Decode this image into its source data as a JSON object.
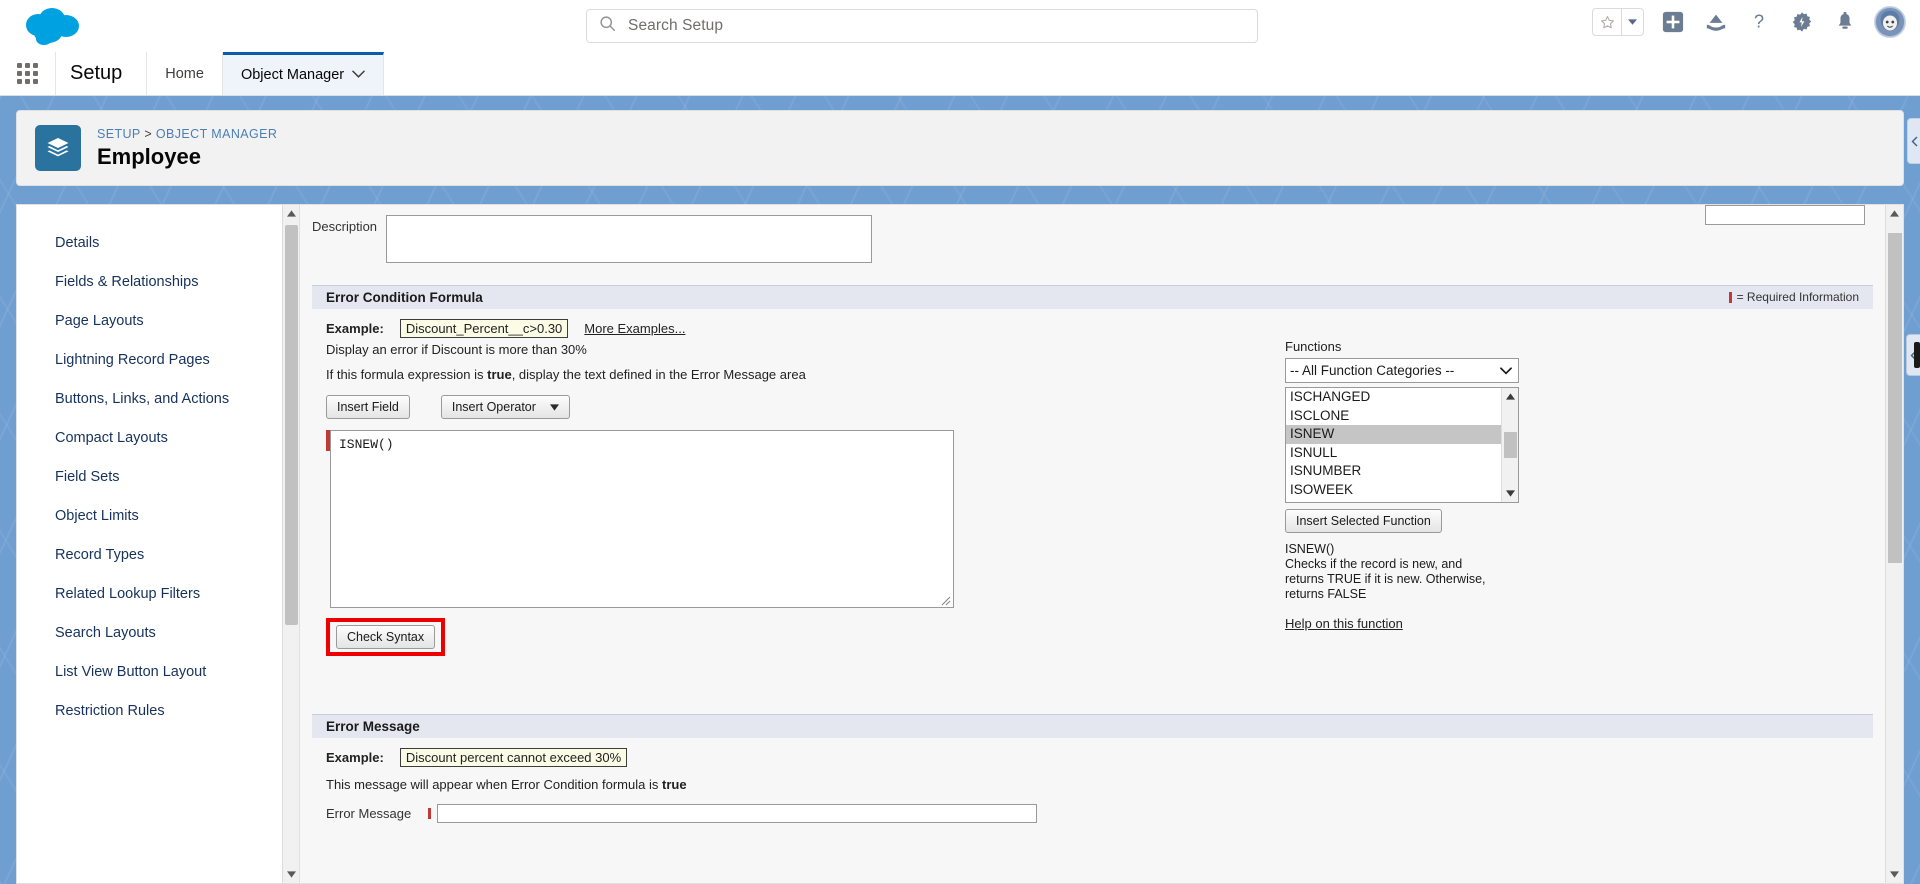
{
  "header": {
    "search_placeholder": "Search Setup",
    "search_icon": "search-icon",
    "logo_icon": "salesforce-cloud-logo",
    "icons": [
      {
        "name": "favorites-star-icon",
        "glyph": "star"
      },
      {
        "name": "favorites-caret-icon",
        "glyph": "caret-down"
      },
      {
        "name": "global-actions-plus-icon",
        "glyph": "plus"
      },
      {
        "name": "trailhead-icon",
        "glyph": "mountain"
      },
      {
        "name": "help-icon",
        "glyph": "question"
      },
      {
        "name": "setup-gear-icon",
        "glyph": "gear-lightning"
      },
      {
        "name": "notifications-bell-icon",
        "glyph": "bell"
      },
      {
        "name": "user-avatar",
        "glyph": "avatar"
      }
    ]
  },
  "setup_nav": {
    "app_launcher_icon": "app-launcher-waffle-icon",
    "title": "Setup",
    "tabs": [
      {
        "label": "Home",
        "active": false,
        "has_caret": false
      },
      {
        "label": "Object Manager",
        "active": true,
        "has_caret": true
      }
    ]
  },
  "record_header": {
    "icon": "object-stack-icon",
    "breadcrumb_root": "SETUP",
    "breadcrumb_sep": ">",
    "breadcrumb_current": "OBJECT MANAGER",
    "title": "Employee"
  },
  "sidebar": {
    "items": [
      {
        "label": "Details"
      },
      {
        "label": "Fields & Relationships"
      },
      {
        "label": "Page Layouts"
      },
      {
        "label": "Lightning Record Pages"
      },
      {
        "label": "Buttons, Links, and Actions"
      },
      {
        "label": "Compact Layouts"
      },
      {
        "label": "Field Sets"
      },
      {
        "label": "Object Limits"
      },
      {
        "label": "Record Types"
      },
      {
        "label": "Related Lookup Filters"
      },
      {
        "label": "Search Layouts"
      },
      {
        "label": "List View Button Layout"
      },
      {
        "label": "Restriction Rules"
      }
    ]
  },
  "form": {
    "description_label": "Description",
    "description_value": "",
    "required_legend": "= Required Information",
    "required_color": "#c23934",
    "highlight_color": "#ee0000"
  },
  "error_condition": {
    "section_title": "Error Condition Formula",
    "example_label": "Example:",
    "example_value": "Discount_Percent__c>0.30",
    "more_examples_link": "More Examples...",
    "example_note": "Display an error if Discount is more than 30%",
    "true_note_before": "If this formula expression is ",
    "true_note_bold": "true",
    "true_note_after": ", display the text defined in the Error Message area",
    "insert_field_button": "Insert Field",
    "insert_operator_button": "Insert Operator",
    "formula_value": "ISNEW()",
    "check_syntax_button": "Check Syntax"
  },
  "functions_panel": {
    "label": "Functions",
    "category_selected": "-- All Function Categories --",
    "list": [
      {
        "name": "ISCHANGED",
        "selected": false
      },
      {
        "name": "ISCLONE",
        "selected": false
      },
      {
        "name": "ISNEW",
        "selected": true
      },
      {
        "name": "ISNULL",
        "selected": false
      },
      {
        "name": "ISNUMBER",
        "selected": false
      },
      {
        "name": "ISOWEEK",
        "selected": false
      }
    ],
    "insert_button": "Insert Selected Function",
    "desc_signature": "ISNEW()",
    "desc_body": "Checks if the record is new, and returns TRUE if it is new. Otherwise, returns FALSE",
    "help_link": "Help on this function"
  },
  "error_message": {
    "section_title": "Error Message",
    "example_label": "Example:",
    "example_value": "Discount percent cannot exceed 30%",
    "note_before": "This message will appear when Error Condition formula is ",
    "note_bold": "true",
    "field_label": "Error Message",
    "field_value": ""
  }
}
